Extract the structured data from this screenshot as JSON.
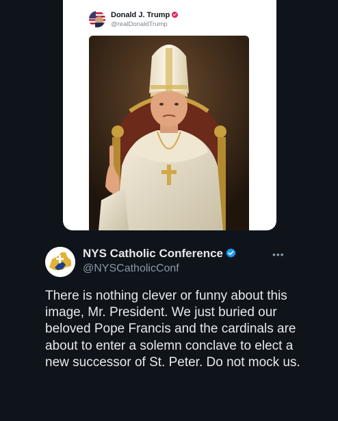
{
  "embedded_post": {
    "author_name": "Donald J. Trump",
    "author_handle": "@realDonaldTrump",
    "avatar_icon": "flag-avatar-icon",
    "badge_color": "#e0245e",
    "image_icon": "pope-portrait-image"
  },
  "post": {
    "author_name": "NYS Catholic Conference",
    "author_handle": "@NYSCatholicConf",
    "avatar_icon": "nys-catholic-conference-logo",
    "verified_color": "#1d9bf0",
    "more_label": "•••",
    "text": "There is nothing clever or funny about this image, Mr. President. We just buried our beloved Pope Francis and the cardinals are about to enter a solemn conclave to elect a new successor of St. Peter. Do not mock us."
  }
}
